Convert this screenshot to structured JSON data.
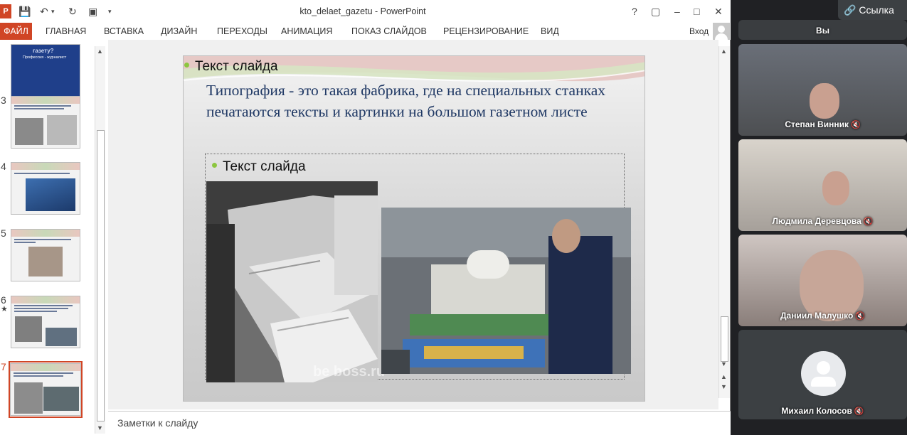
{
  "app": {
    "doc_title": "kto_delaet_gazetu - PowerPoint",
    "logo_text": "P",
    "titlebar_buttons": [
      "?",
      "▢",
      "–",
      "□",
      "✕"
    ]
  },
  "ribbon": {
    "file_tab": "ФАЙЛ",
    "tabs": [
      "ГЛАВНАЯ",
      "ВСТАВКА",
      "ДИЗАЙН",
      "ПЕРЕХОДЫ",
      "АНИМАЦИЯ",
      "ПОКАЗ СЛАЙДОВ",
      "РЕЦЕНЗИРОВАНИЕ",
      "ВИД"
    ],
    "sign_in": "Вход"
  },
  "thumbnails": [
    {
      "number": "",
      "title": "газету?",
      "subtitle": "Профессия - журналист"
    },
    {
      "number": "3"
    },
    {
      "number": "4"
    },
    {
      "number": "5"
    },
    {
      "number": "6",
      "mark": "★"
    },
    {
      "number": "7",
      "selected": true
    }
  ],
  "slide": {
    "label1": "Текст слайда",
    "heading": "Типография - это  такая фабрика, где на специальных станках печатаются тексты и картинки на большом газетном листе",
    "label2": "Текст слайда",
    "watermark": "be boss.ru"
  },
  "notes": {
    "placeholder": "Заметки к слайду"
  },
  "meet": {
    "link_button": "Ссылка",
    "self_label": "Вы",
    "participants": [
      {
        "name": "Степан Винник",
        "muted": true
      },
      {
        "name": "Людмила Деревцова",
        "muted": true
      },
      {
        "name": "Даниил Малушко",
        "muted": true
      },
      {
        "name": "Михаил Колосов",
        "muted": true
      }
    ]
  },
  "colors": {
    "accent": "#d04525",
    "slide_heading": "#1f3864",
    "bullet": "#8cc63f",
    "meet_bg": "#202124"
  }
}
